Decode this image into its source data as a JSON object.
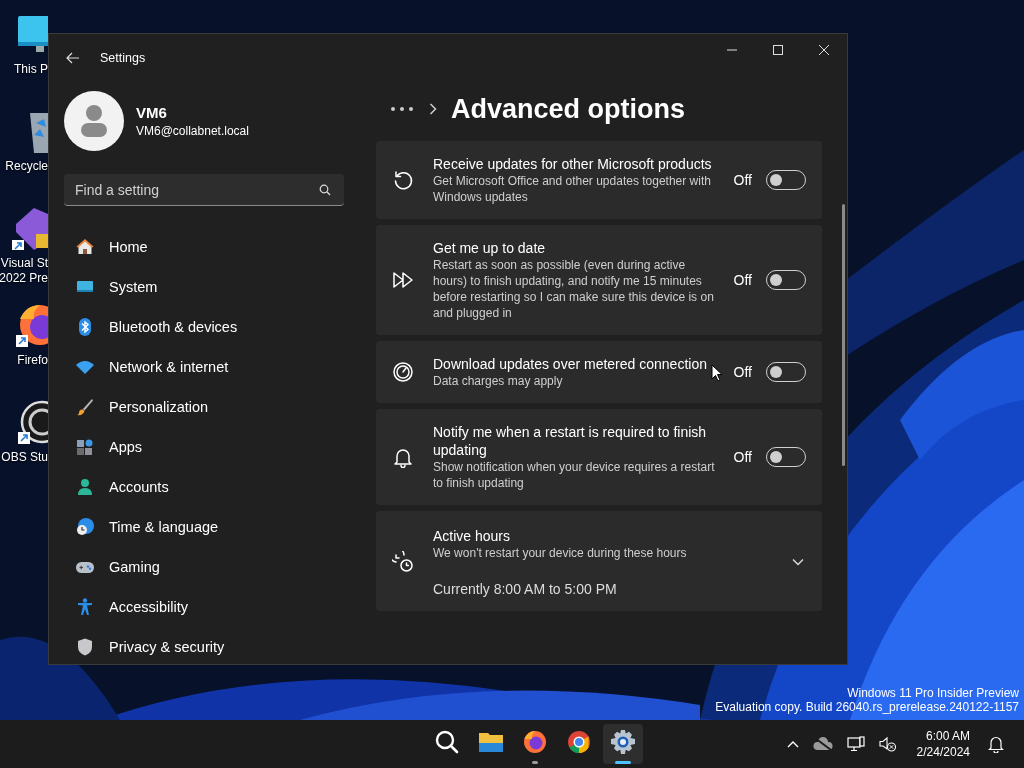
{
  "desktop_icons": [
    {
      "lines": [
        "This P"
      ]
    },
    {
      "lines": [
        "Recycle"
      ]
    },
    {
      "lines": [
        "Visual St",
        "2022 Pre"
      ]
    },
    {
      "lines": [
        "Firefo"
      ]
    },
    {
      "lines": [
        "OBS Stu"
      ]
    }
  ],
  "window": {
    "title": "Settings"
  },
  "profile": {
    "name": "VM6",
    "email": "VM6@collabnet.local"
  },
  "search": {
    "placeholder": "Find a setting"
  },
  "nav": [
    {
      "label": "Home",
      "selected": false
    },
    {
      "label": "System",
      "selected": false
    },
    {
      "label": "Bluetooth & devices",
      "selected": false
    },
    {
      "label": "Network & internet",
      "selected": false
    },
    {
      "label": "Personalization",
      "selected": false
    },
    {
      "label": "Apps",
      "selected": false
    },
    {
      "label": "Accounts",
      "selected": false
    },
    {
      "label": "Time & language",
      "selected": false
    },
    {
      "label": "Gaming",
      "selected": false
    },
    {
      "label": "Accessibility",
      "selected": false
    },
    {
      "label": "Privacy & security",
      "selected": false
    }
  ],
  "page_title": "Advanced options",
  "settings": [
    {
      "kind": "toggle",
      "title": "Receive updates for other Microsoft products",
      "description": "Get Microsoft Office and other updates together with Windows updates",
      "state_label": "Off",
      "on": false
    },
    {
      "kind": "toggle",
      "title": "Get me up to date",
      "description": "Restart as soon as possible (even during active hours) to finish updating, and notify me 15 minutes before restarting so I can make sure this device is on and plugged in",
      "state_label": "Off",
      "on": false
    },
    {
      "kind": "toggle",
      "title": "Download updates over metered connection",
      "description": "Data charges may apply",
      "state_label": "Off",
      "on": false
    },
    {
      "kind": "toggle",
      "title": "Notify me when a restart is required to finish updating",
      "description": "Show notification when your device requires a restart to finish updating",
      "state_label": "Off",
      "on": false
    },
    {
      "kind": "expander",
      "title": "Active hours",
      "description": "We won't restart your device during these hours",
      "status": "Currently 8:00 AM to 5:00 PM",
      "expanded": false
    }
  ],
  "build_info": [
    "Windows 11 Pro Insider Preview",
    "Evaluation copy. Build 26040.rs_prerelease.240122-1157"
  ],
  "taskbar_apps": [
    {
      "running": false,
      "selected": false
    },
    {
      "running": false,
      "selected": false
    },
    {
      "running": true,
      "selected": false
    },
    {
      "running": false,
      "selected": false
    },
    {
      "running": true,
      "selected": true
    }
  ],
  "clock": {
    "time": "6:00 AM",
    "date": "2/24/2024"
  }
}
